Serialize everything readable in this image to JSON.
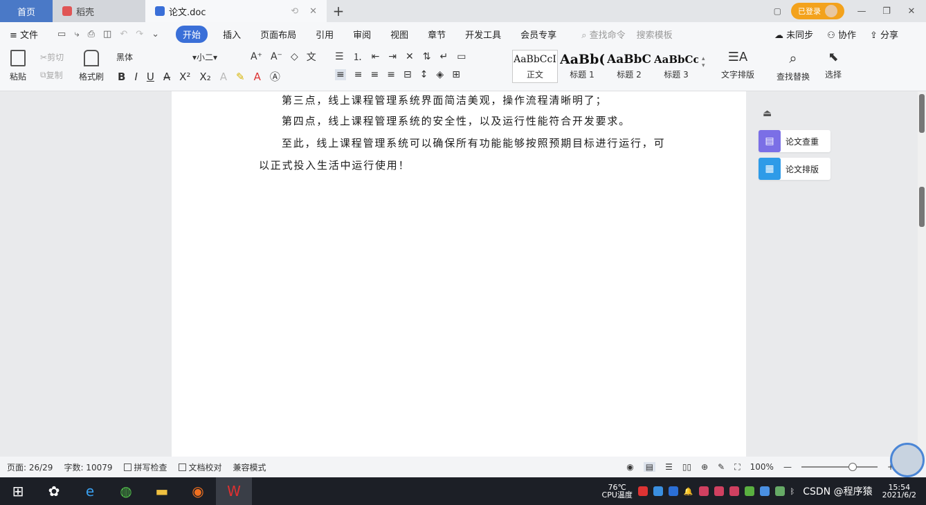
{
  "titlebar": {
    "tabs": [
      {
        "label": "首页"
      },
      {
        "label": "稻壳"
      },
      {
        "label": "论文.doc"
      }
    ],
    "vip_label": "已登录"
  },
  "menubar": {
    "file": "文件",
    "items": [
      "开始",
      "插入",
      "页面布局",
      "引用",
      "审阅",
      "视图",
      "章节",
      "开发工具",
      "会员专享"
    ],
    "search": "查找命令",
    "search_template": "搜索模板",
    "unsynced": "未同步",
    "collab": "协作",
    "share": "分享"
  },
  "ribbon": {
    "paste": "粘贴",
    "cut": "剪切",
    "copy": "复制",
    "format_painter": "格式刷",
    "font_name": "黑体",
    "font_size": "小二",
    "styles": [
      {
        "sample": "AaBbCcI",
        "name": "正文"
      },
      {
        "sample": "AaBb(",
        "name": "标题 1"
      },
      {
        "sample": "AaBbC",
        "name": "标题 2"
      },
      {
        "sample": "AaBbCcI",
        "name": "标题 3"
      }
    ],
    "text_layout": "文字排版",
    "find_replace": "查找替换",
    "select": "选择"
  },
  "document": {
    "lines": [
      "第三点，线上课程管理系统界面简洁美观，操作流程清晰明了；",
      "第四点，线上课程管理系统的安全性，以及运行性能符合开发要求。",
      "至此，线上课程管理系统可以确保所有功能能够按照预期目标进行运行，可",
      "以正式投入生活中运行使用！"
    ]
  },
  "side_panel": {
    "buttons": [
      "论文查重",
      "论文排版"
    ]
  },
  "statusbar": {
    "page": "页面: 26/29",
    "words": "字数: 10079",
    "spell": "拼写检查",
    "proof": "文档校对",
    "mode": "兼容模式",
    "zoom": "100%",
    "zoom_level": 0.62
  },
  "taskbar": {
    "temp": "76℃",
    "cpu": "CPU温度",
    "watermark": "CSDN @程序猿",
    "time": "15:54",
    "date": "2021/6/2"
  },
  "colors": {
    "accent": "#3a6fd8",
    "home_tab": "#4a79c7",
    "vip": "#f3a21c",
    "check_icon": "#7b6fe6",
    "layout_icon": "#2e9be8",
    "taskbar": "#1c1f26"
  }
}
